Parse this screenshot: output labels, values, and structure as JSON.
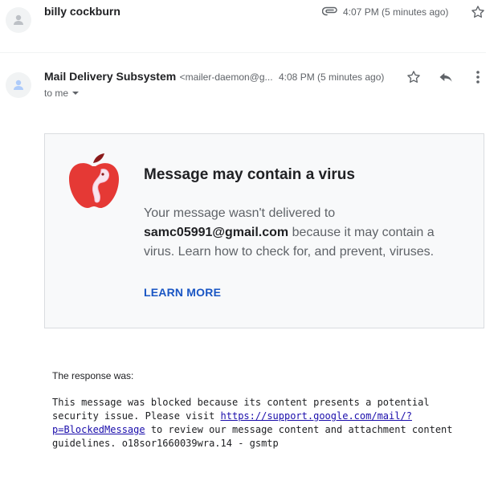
{
  "first_message": {
    "sender": "billy cockburn",
    "time": "4:07 PM (5 minutes ago)",
    "icons": [
      "avatar-icon",
      "attachment-icon",
      "star-icon"
    ]
  },
  "second_message": {
    "sender_name": "Mail Delivery Subsystem",
    "sender_email": "<mailer-daemon@g...",
    "time": "4:08 PM (5 minutes ago)",
    "recipient": "to me",
    "icons": [
      "avatar-icon",
      "star-icon",
      "reply-icon",
      "more-vert-icon",
      "chevron-down-icon"
    ]
  },
  "warning": {
    "title": "Message may contain a virus",
    "body_prefix": "Your message wasn't delivered to ",
    "email": "samc05991@gmail.com",
    "body_suffix": " because it may contain a virus. Learn how to check for, and prevent, viruses.",
    "learn_more": "LEARN MORE",
    "icon": "apple-worm-icon"
  },
  "response": {
    "label": "The response was:",
    "text_before_link": "This message was blocked because its content presents a potential security issue. Please visit ",
    "link": "https://support.google.com/mail/?p=BlockedMessage",
    "text_after_link": " to review our message content and attachment content guidelines. o18sor1660039wra.14 - gsmtp"
  },
  "colors": {
    "accent_link": "#1a56c4",
    "apple_red": "#e53935",
    "card_bg": "#f8f9fa"
  }
}
